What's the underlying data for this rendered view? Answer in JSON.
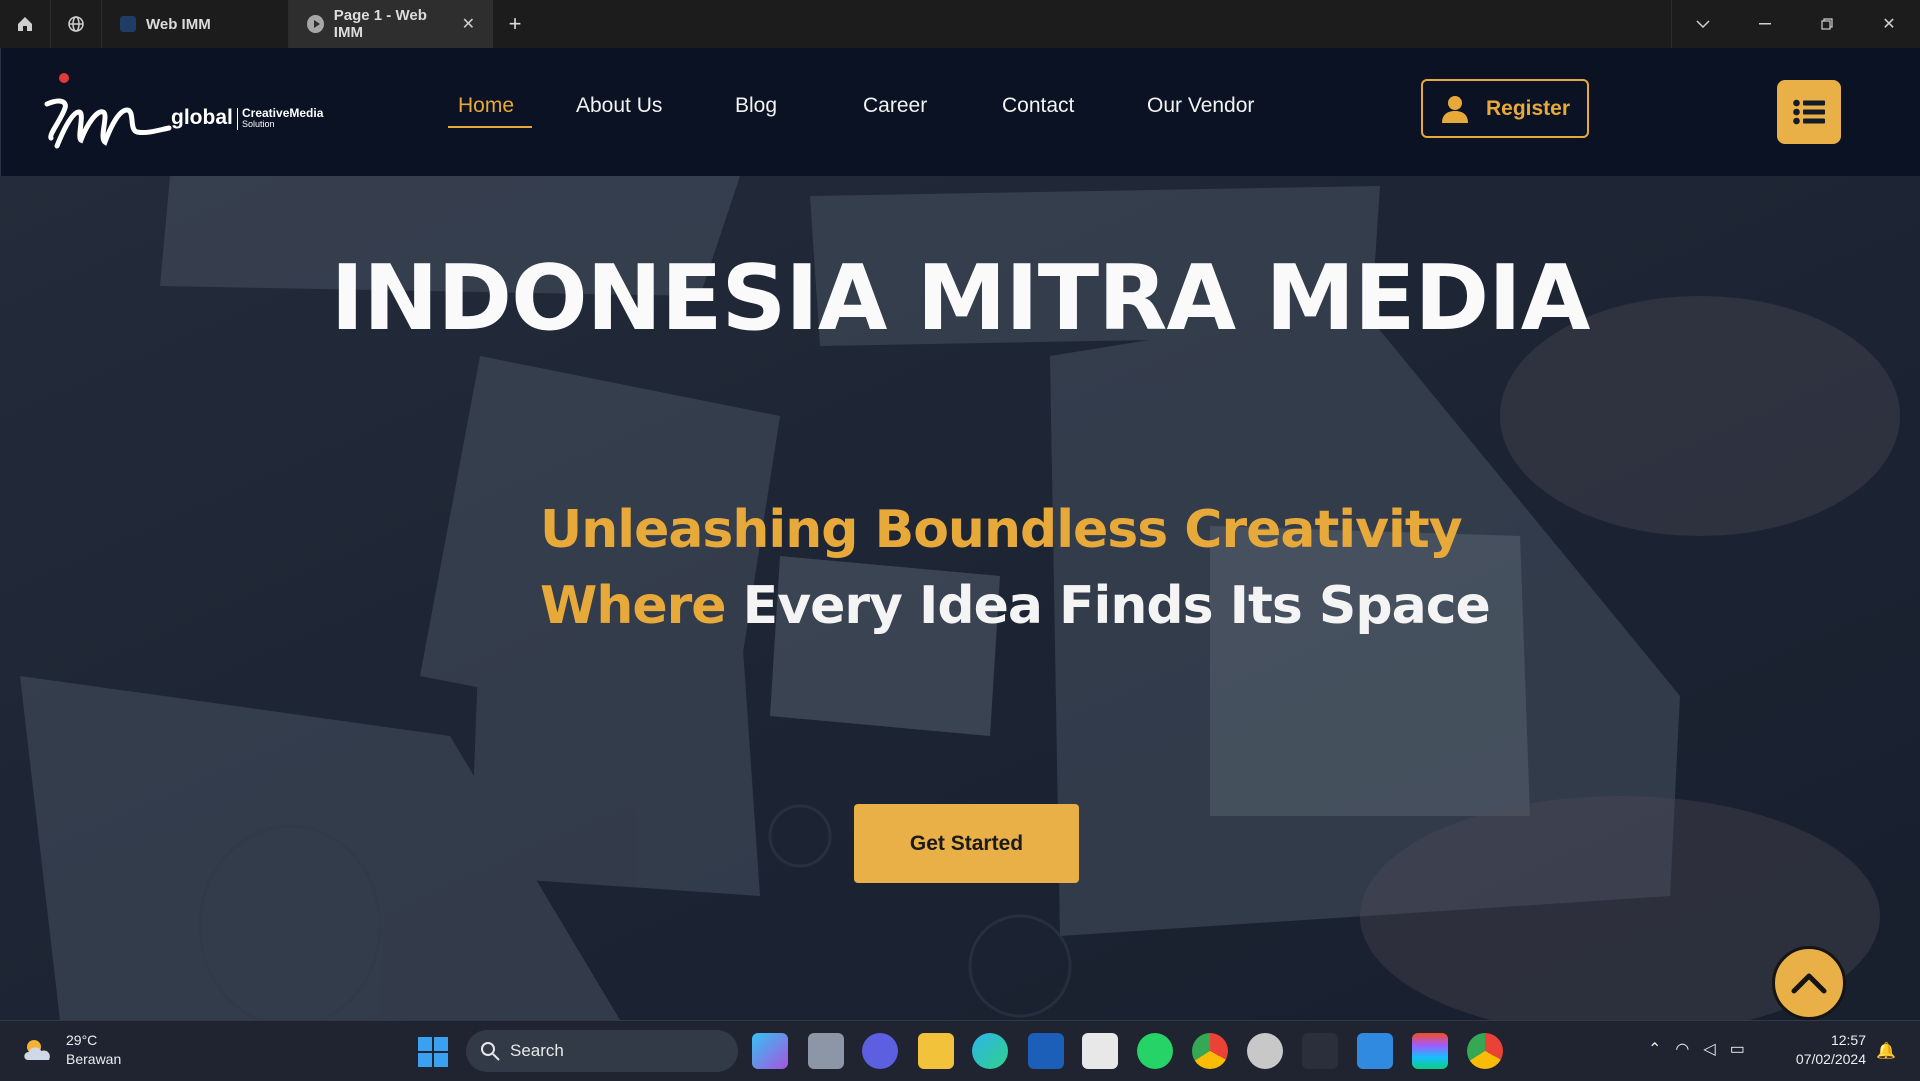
{
  "browser": {
    "tabs": [
      {
        "title": "Web IMM",
        "active": false
      },
      {
        "title": "Page 1 - Web IMM",
        "active": true
      }
    ],
    "icons": [
      "home-icon",
      "globe-icon",
      "new-tab-icon",
      "tab-list-icon",
      "minimize-icon",
      "restore-icon",
      "close-icon"
    ]
  },
  "site": {
    "logo": {
      "word": "global",
      "brand": "CreativeMedia",
      "tagline": "Solution"
    },
    "nav": [
      {
        "label": "Home",
        "active": true
      },
      {
        "label": "About Us"
      },
      {
        "label": "Blog"
      },
      {
        "label": "Career"
      },
      {
        "label": "Contact"
      },
      {
        "label": "Our Vendor"
      }
    ],
    "register_label": "Register",
    "accent_color": "#e8a93b"
  },
  "hero": {
    "title": "INDONESIA MITRA MEDIA",
    "line1": "Unleashing Boundless Creativity",
    "line2_gold": "Where",
    "line2_white": "Every Idea Finds Its Space",
    "cta_label": "Get Started"
  },
  "taskbar": {
    "weather": {
      "temp": "29°C",
      "condition": "Berawan"
    },
    "search_placeholder": "Search",
    "time": "12:57",
    "date": "07/02/2024"
  }
}
